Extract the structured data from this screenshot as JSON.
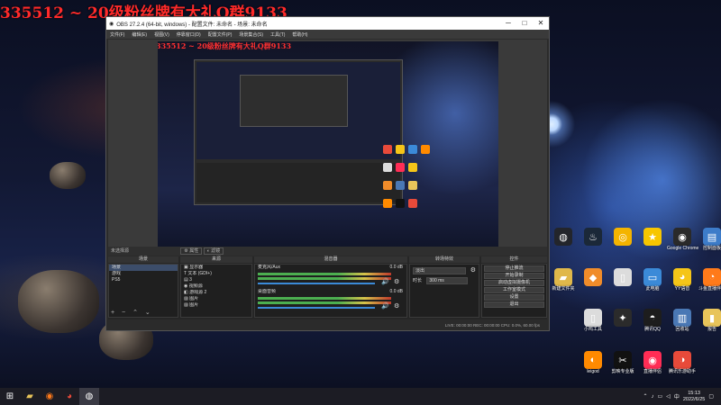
{
  "banner": "335512 ~ 20级粉丝牌有大礼Q群9133",
  "obs": {
    "title": "OBS 27.2.4 (64-bit, windows) - 配置文件: 未命名 - 场景: 未命名",
    "menu": [
      "文件(F)",
      "编辑(E)",
      "视图(V)",
      "停靠窗口(D)",
      "配置文件(P)",
      "场景集合(S)",
      "工具(T)",
      "帮助(H)"
    ],
    "preview_banner": "335512 ~ 20级粉丝牌有大礼Q群9133",
    "source_bar": {
      "label": "未选择源",
      "properties": "属性",
      "filters": "滤镜"
    },
    "docks": {
      "scenes": "场景",
      "sources": "来源",
      "mixer": "混音器",
      "transitions": "转场特效",
      "controls": "控件"
    },
    "scenes": [
      "场景",
      "游戏",
      "PS5"
    ],
    "sources": [
      "显示器",
      "文本 (GDI+)",
      "3",
      "视频源",
      "游戏源 2",
      "图片",
      "图片"
    ],
    "mixer": [
      {
        "name": "麦克风/Aux",
        "db": "0.0 dB"
      },
      {
        "name": "桌面音频",
        "db": "0.0 dB"
      }
    ],
    "transitions": {
      "type": "淡出",
      "duration_label": "时长",
      "duration": "300 ms"
    },
    "controls": [
      "停止推流",
      "开始录制",
      "启动虚拟摄像机",
      "工作室模式",
      "设置",
      "退出"
    ],
    "status": "LIVE: 00:00:00   REC: 00:00:00   CPU: 0.0%, 60.00 fps"
  },
  "desktop_icons": [
    {
      "label": "",
      "color": "#23252b",
      "glyph": "◍",
      "col": 0,
      "row": 0
    },
    {
      "label": "",
      "color": "#1b2838",
      "glyph": "♨",
      "col": 1,
      "row": 0
    },
    {
      "label": "",
      "color": "#f4b400",
      "glyph": "◎",
      "col": 2,
      "row": 0
    },
    {
      "label": "",
      "color": "#f7c600",
      "glyph": "★",
      "col": 3,
      "row": 0
    },
    {
      "label": "Google Chrome",
      "color": "#2a2a2a",
      "glyph": "◉",
      "col": 4,
      "row": 0
    },
    {
      "label": "控制面板",
      "color": "#3d7cc9",
      "glyph": "▤",
      "col": 5,
      "row": 0
    },
    {
      "label": "新建文件夹",
      "color": "#e0b84a",
      "glyph": "▰",
      "col": 0,
      "row": 1
    },
    {
      "label": "",
      "color": "#f08c2a",
      "glyph": "◆",
      "col": 1,
      "row": 1
    },
    {
      "label": "",
      "color": "#dcdcdc",
      "glyph": "▯",
      "col": 2,
      "row": 1
    },
    {
      "label": "此电脑",
      "color": "#3b8ad8",
      "glyph": "▭",
      "col": 3,
      "row": 1
    },
    {
      "label": "YY语音",
      "color": "#f5c518",
      "glyph": "◕",
      "col": 4,
      "row": 1
    },
    {
      "label": "斗鱼直播伴侣",
      "color": "#ff7a1a",
      "glyph": "◔",
      "col": 5,
      "row": 1
    },
    {
      "label": "小鸡工具",
      "color": "#dcdcdc",
      "glyph": "▯",
      "col": 1,
      "row": 2
    },
    {
      "label": "",
      "color": "#2b2b2b",
      "glyph": "✦",
      "col": 2,
      "row": 2
    },
    {
      "label": "腾讯QQ",
      "color": "#1d1d1d",
      "glyph": "◓",
      "col": 3,
      "row": 2
    },
    {
      "label": "回收站",
      "color": "#4a78b5",
      "glyph": "▥",
      "col": 4,
      "row": 2
    },
    {
      "label": "报告",
      "color": "#e8c45a",
      "glyph": "▮",
      "col": 5,
      "row": 2
    },
    {
      "label": "leigod",
      "color": "#ff8a00",
      "glyph": "◐",
      "col": 1,
      "row": 3
    },
    {
      "label": "剪映专业版",
      "color": "#111111",
      "glyph": "✂",
      "col": 2,
      "row": 3
    },
    {
      "label": "直播伴侣",
      "color": "#ff2d55",
      "glyph": "◉",
      "col": 3,
      "row": 3
    },
    {
      "label": "腾讯乐游助手",
      "color": "#e84a3a",
      "glyph": "◑",
      "col": 4,
      "row": 3
    }
  ],
  "taskbar": {
    "clock_time": "15:13",
    "clock_date": "2022/6/25"
  }
}
